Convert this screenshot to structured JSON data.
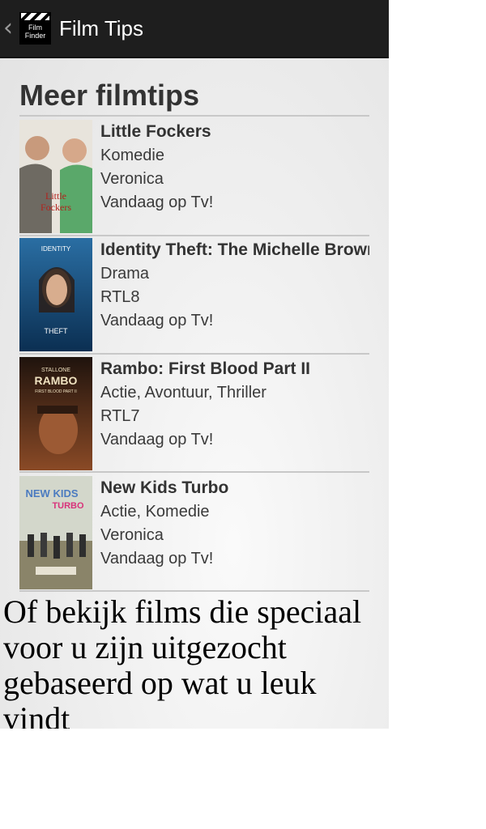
{
  "app": {
    "title": "Film Tips",
    "logo_text": "Film\nFinder",
    "back_icon": "chevron-left-icon"
  },
  "section_title": "Meer filmtips",
  "movies": [
    {
      "title": "Little Fockers",
      "genre": "Komedie",
      "channel": "Veronica",
      "airing": "Vandaag op Tv!",
      "poster_colors": {
        "top": "#e8e4dc",
        "bottom": "#5aa86a",
        "text": "#b2221d"
      },
      "poster_text": [
        "Little",
        "Fockers"
      ]
    },
    {
      "title": "Identity Theft: The Michelle Brown Story",
      "genre": "Drama",
      "channel": "RTL8",
      "airing": "Vandaag op Tv!",
      "poster_colors": {
        "top": "#1b5a8a",
        "bottom": "#0b2f52",
        "text": "#ffffff"
      },
      "poster_text": [
        "IDENTITY",
        "THEFT"
      ]
    },
    {
      "title": "Rambo: First Blood Part II",
      "genre": "Actie, Avontuur, Thriller",
      "channel": "RTL7",
      "airing": "Vandaag op Tv!",
      "poster_colors": {
        "top": "#2b1a12",
        "bottom": "#8a4a26",
        "text": "#f0e2c0"
      },
      "poster_text": [
        "STALLONE",
        "RAMBO",
        "FIRST BLOOD PART II"
      ]
    },
    {
      "title": "New Kids Turbo",
      "genre": "Actie, Komedie",
      "channel": "Veronica",
      "airing": "Vandaag op Tv!",
      "poster_colors": {
        "top": "#cfd3c7",
        "bottom": "#7e7a63",
        "text": "#d8327a"
      },
      "poster_text": [
        "NEW KIDS",
        "TURBO"
      ]
    }
  ],
  "bottom_text": "Of bekijk films die speciaal voor u zijn uitgezocht gebaseerd op wat u leuk vindt"
}
